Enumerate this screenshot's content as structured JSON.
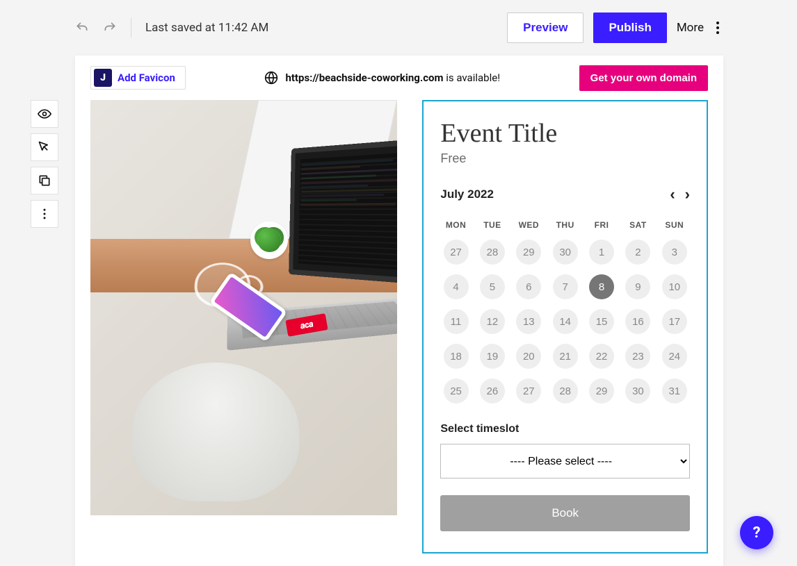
{
  "topbar": {
    "last_saved": "Last saved at 11:42 AM",
    "preview": "Preview",
    "publish": "Publish",
    "more": "More"
  },
  "favicon": {
    "logo_letter": "J",
    "label": "Add Favicon"
  },
  "domain": {
    "url": "https://beachside-coworking.com",
    "available": " is available!",
    "cta": "Get your own domain"
  },
  "event": {
    "title": "Event Title",
    "price": "Free",
    "month": "July 2022",
    "dow": [
      "MON",
      "TUE",
      "WED",
      "THU",
      "FRI",
      "SAT",
      "SUN"
    ],
    "days": [
      {
        "n": "27",
        "muted": true
      },
      {
        "n": "28",
        "muted": true
      },
      {
        "n": "29",
        "muted": true
      },
      {
        "n": "30",
        "muted": true
      },
      {
        "n": "1"
      },
      {
        "n": "2"
      },
      {
        "n": "3"
      },
      {
        "n": "4"
      },
      {
        "n": "5"
      },
      {
        "n": "6"
      },
      {
        "n": "7"
      },
      {
        "n": "8",
        "selected": true
      },
      {
        "n": "9"
      },
      {
        "n": "10"
      },
      {
        "n": "11"
      },
      {
        "n": "12"
      },
      {
        "n": "13"
      },
      {
        "n": "14"
      },
      {
        "n": "15"
      },
      {
        "n": "16"
      },
      {
        "n": "17"
      },
      {
        "n": "18"
      },
      {
        "n": "19"
      },
      {
        "n": "20"
      },
      {
        "n": "21"
      },
      {
        "n": "22"
      },
      {
        "n": "23"
      },
      {
        "n": "24"
      },
      {
        "n": "25"
      },
      {
        "n": "26"
      },
      {
        "n": "27"
      },
      {
        "n": "28"
      },
      {
        "n": "29"
      },
      {
        "n": "30"
      },
      {
        "n": "31"
      }
    ],
    "timeslot_label": "Select timeslot",
    "timeslot_placeholder": "---- Please select ----",
    "book": "Book"
  },
  "sticker": "aca",
  "help": "?"
}
